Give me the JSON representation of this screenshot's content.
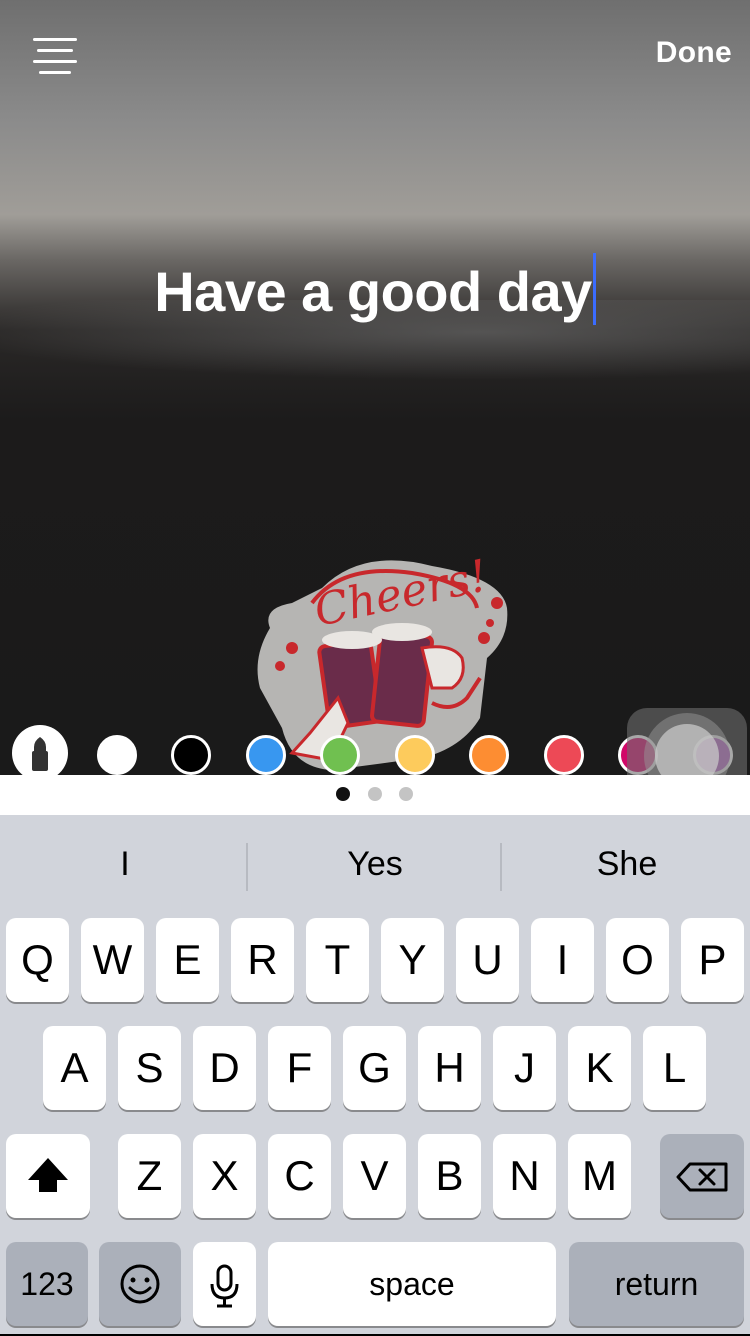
{
  "toolbar": {
    "done_label": "Done"
  },
  "caption": {
    "text": "Have a good day"
  },
  "sticker": {
    "text": "Cheers!"
  },
  "palette": {
    "colors": [
      "#ffffff",
      "#000000",
      "#3897f0",
      "#70c050",
      "#fdcb5c",
      "#fd8d32",
      "#ed4956",
      "#d10869",
      "#a307ba"
    ]
  },
  "page_indicator": {
    "count": 3,
    "active": 0
  },
  "suggestions": [
    "I",
    "Yes",
    "She"
  ],
  "keyboard": {
    "row1": [
      "Q",
      "W",
      "E",
      "R",
      "T",
      "Y",
      "U",
      "I",
      "O",
      "P"
    ],
    "row2": [
      "A",
      "S",
      "D",
      "F",
      "G",
      "H",
      "J",
      "K",
      "L"
    ],
    "row3": [
      "Z",
      "X",
      "C",
      "V",
      "B",
      "N",
      "M"
    ],
    "numbers_label": "123",
    "space_label": "space",
    "return_label": "return"
  },
  "icons": [
    "menu-icon",
    "brush-icon",
    "shift-icon",
    "backspace-icon",
    "emoji-icon",
    "microphone-icon",
    "assistive-touch-icon"
  ]
}
